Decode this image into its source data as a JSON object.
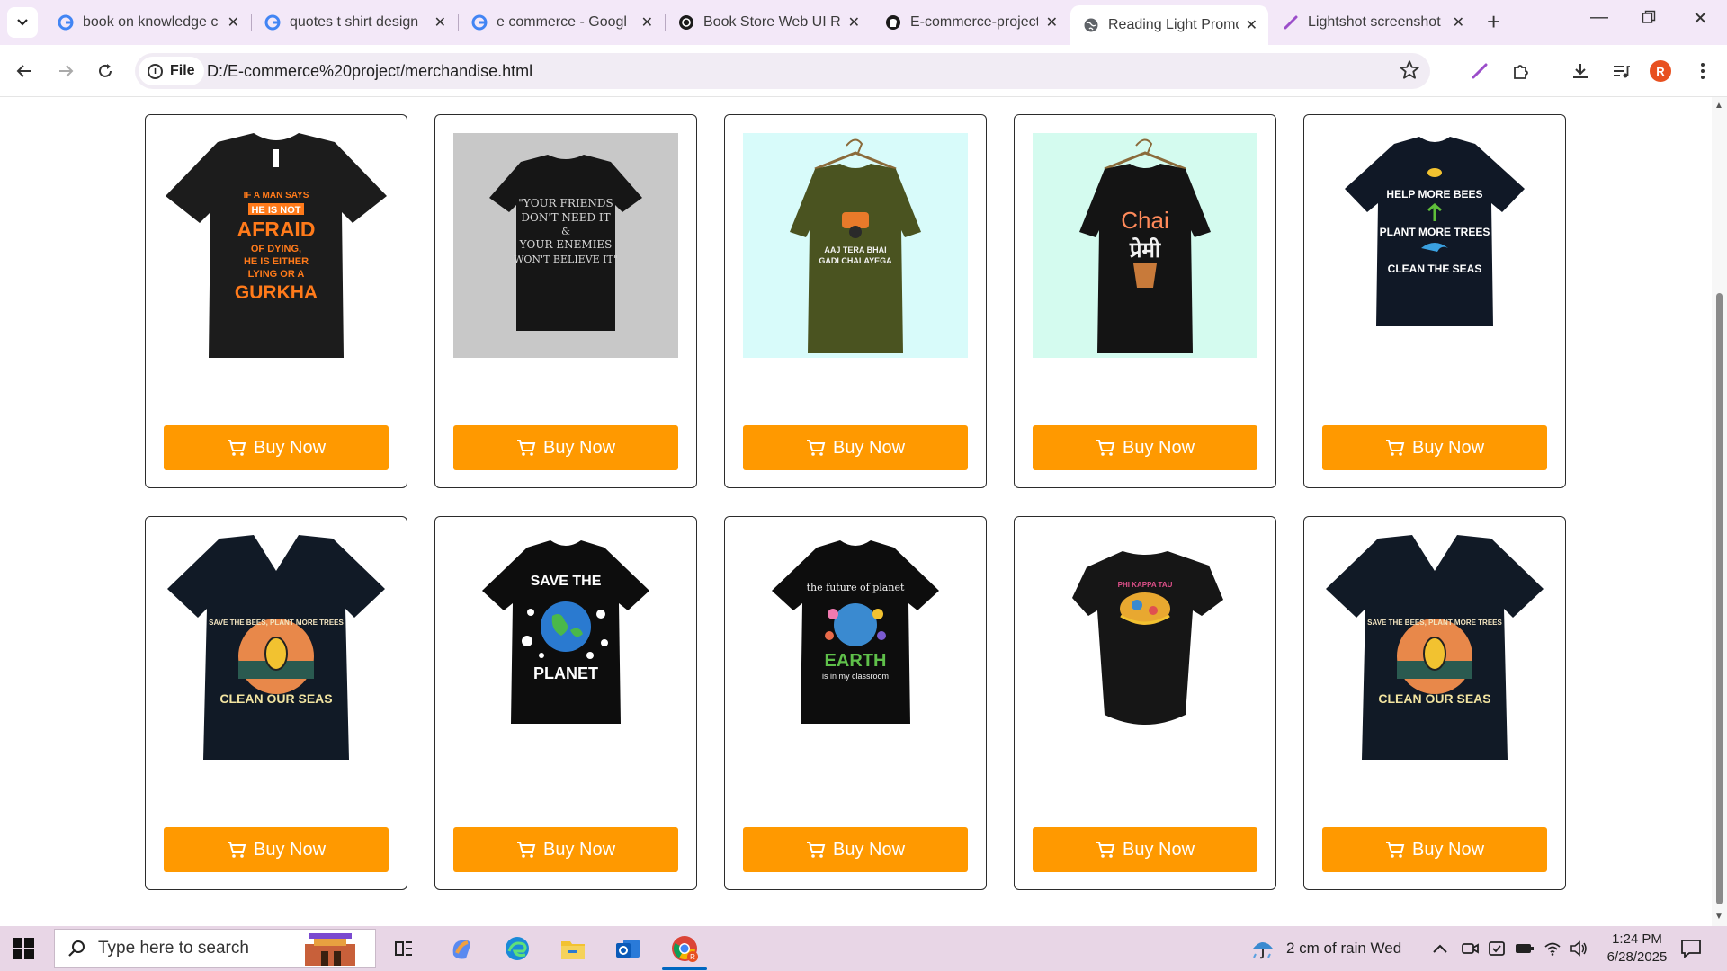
{
  "browser": {
    "tabs": [
      {
        "title": "book on knowledge c",
        "favicon": "google-icon",
        "active": false
      },
      {
        "title": "quotes t shirt design",
        "favicon": "google-icon",
        "active": false
      },
      {
        "title": "e commerce - Googl",
        "favicon": "google-icon",
        "active": false
      },
      {
        "title": "Book Store Web UI R",
        "favicon": "openai-icon",
        "active": false
      },
      {
        "title": "E-commerce-project",
        "favicon": "github-icon",
        "active": false
      },
      {
        "title": "Reading Light Promo",
        "favicon": "globe-icon",
        "active": true
      },
      {
        "title": "Lightshot screenshot",
        "favicon": "lightshot-icon",
        "active": false
      }
    ],
    "address": {
      "scheme_label": "File",
      "url": "D:/E-commerce%20project/merchandise.html"
    },
    "profile_initial": "R"
  },
  "page": {
    "button_label": "Buy Now",
    "accent_color": "#ff9900",
    "products": [
      {
        "design": "If a man says he is not afraid of dying, he is either lying or a Gurkha",
        "lines": [
          "IF A MAN SAYS",
          "HE IS NOT",
          "AFRAID",
          "OF DYING,",
          "HE IS EITHER",
          "LYING OR A",
          "GURKHA"
        ],
        "shirt": "black-crew",
        "bg": "#ffffff"
      },
      {
        "design": "Your friends don't need it & your enemies won't believe it",
        "lines": [
          "\"YOUR FRIENDS",
          "DON'T NEED IT",
          "&",
          "YOUR ENEMIES",
          "WON'T BELIEVE IT\""
        ],
        "shirt": "black-crew",
        "bg": "#c8c8c8"
      },
      {
        "design": "Aaj tera bhai gadi chalayega",
        "lines": [
          "AAJ TERA BHAI",
          "GADI CHALAYEGA"
        ],
        "shirt": "olive-hanger",
        "bg": "#d8fbfa"
      },
      {
        "design": "Chai Premi",
        "lines": [
          "Chai",
          "प्रेमी"
        ],
        "shirt": "black-hanger",
        "bg": "#d4fbef"
      },
      {
        "design": "Help more bees, plant more trees, clean the seas",
        "lines": [
          "HELP MORE BEES",
          "PLANT MORE TREES",
          "CLEAN THE SEAS"
        ],
        "shirt": "black-crew",
        "bg": "#ffffff"
      },
      {
        "design": "Save the bees, plant more trees, clean our seas",
        "lines": [
          "SAVE THE BEES, PLANT MORE TREES",
          "CLEAN OUR SEAS"
        ],
        "shirt": "black-vneck",
        "bg": "#ffffff"
      },
      {
        "design": "Save the planet",
        "lines": [
          "SAVE THE",
          "PLANET"
        ],
        "shirt": "black-crew",
        "bg": "#ffffff"
      },
      {
        "design": "The future of planet Earth is in my classroom",
        "lines": [
          "the future of planet",
          "EARTH",
          "is in my classroom"
        ],
        "shirt": "black-crew",
        "bg": "#ffffff"
      },
      {
        "design": "Phi Kappa Tau",
        "lines": [
          "PHI KAPPA TAU"
        ],
        "shirt": "black-folded",
        "bg": "#ffffff"
      },
      {
        "design": "Save the bees, plant more trees, clean our seas",
        "lines": [
          "SAVE THE BEES, PLANT MORE TREES",
          "CLEAN OUR SEAS"
        ],
        "shirt": "black-vneck",
        "bg": "#ffffff"
      }
    ]
  },
  "taskbar": {
    "search_placeholder": "Type here to search",
    "weather": "2 cm of rain Wed",
    "time": "1:24 PM",
    "date": "6/28/2025"
  }
}
